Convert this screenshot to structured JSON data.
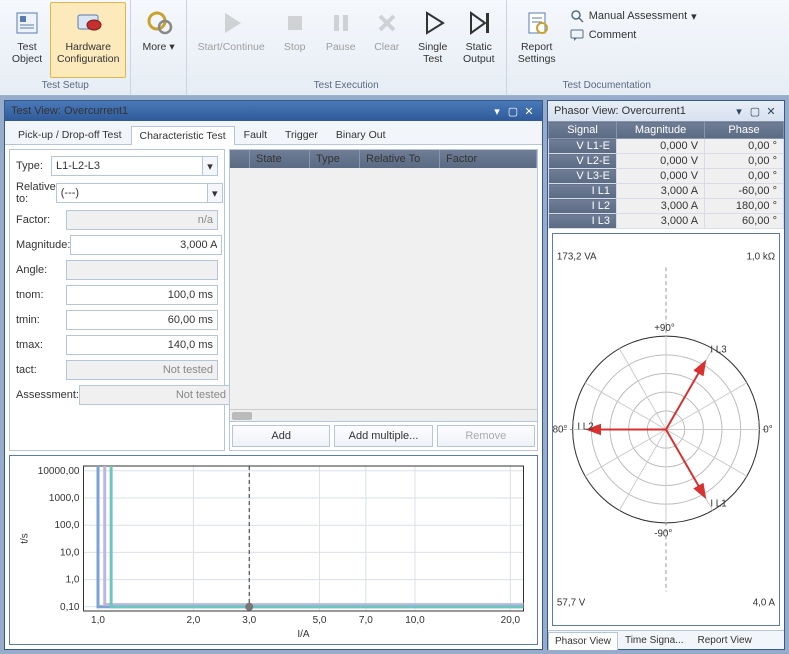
{
  "ribbon": {
    "groups": [
      {
        "label": "Test Setup",
        "buttons": [
          {
            "name": "test-object",
            "label": "Test\nObject",
            "icon": "test-object-icon"
          },
          {
            "name": "hardware-config",
            "label": "Hardware\nConfiguration",
            "icon": "hardware-config-icon",
            "active": true
          }
        ]
      },
      {
        "label": "",
        "buttons": [
          {
            "name": "more",
            "label": "More",
            "icon": "gear-icon",
            "dd": true
          }
        ]
      },
      {
        "label": "Test Execution",
        "buttons": [
          {
            "name": "start",
            "label": "Start/Continue",
            "icon": "play-icon",
            "disabled": true
          },
          {
            "name": "stop",
            "label": "Stop",
            "icon": "stop-icon",
            "disabled": true
          },
          {
            "name": "pause",
            "label": "Pause",
            "icon": "pause-icon",
            "disabled": true
          },
          {
            "name": "clear",
            "label": "Clear",
            "icon": "x-icon",
            "disabled": true
          },
          {
            "name": "single-test",
            "label": "Single\nTest",
            "icon": "play-outline-icon"
          },
          {
            "name": "static-output",
            "label": "Static\nOutput",
            "icon": "playbar-icon"
          }
        ]
      },
      {
        "label": "Test Documentation",
        "buttons": [
          {
            "name": "report-settings",
            "label": "Report\nSettings",
            "icon": "report-icon"
          }
        ],
        "side": [
          {
            "name": "manual-assessment",
            "label": "Manual Assessment",
            "icon": "search-icon",
            "dd": true
          },
          {
            "name": "comment",
            "label": "Comment",
            "icon": "comment-icon"
          }
        ]
      }
    ]
  },
  "testview": {
    "title": "Test View: Overcurrent1",
    "tabs": [
      "Pick-up / Drop-off Test",
      "Characteristic Test",
      "Fault",
      "Trigger",
      "Binary Out"
    ],
    "active_tab": 1,
    "form": {
      "type": {
        "label": "Type:",
        "value": "L1-L2-L3"
      },
      "relative": {
        "label": "Relative to:",
        "value": "(---)"
      },
      "factor": {
        "label": "Factor:",
        "value": "n/a",
        "ro": true
      },
      "magnitude": {
        "label": "Magnitude:",
        "value": "3,000 A"
      },
      "angle": {
        "label": "Angle:",
        "value": "",
        "ro": true
      },
      "tnom": {
        "label": "tnom:",
        "value": "100,0 ms"
      },
      "tmin": {
        "label": "tmin:",
        "value": "60,00 ms"
      },
      "tmax": {
        "label": "tmax:",
        "value": "140,0 ms"
      },
      "tact": {
        "label": "tact:",
        "value": "Not tested",
        "ro": true
      },
      "assessment": {
        "label": "Assessment:",
        "value": "Not tested",
        "ro": true
      }
    },
    "grid": {
      "cols": [
        "",
        "State",
        "Type",
        "Relative To",
        "Factor"
      ]
    },
    "buttons": {
      "add": "Add",
      "addm": "Add multiple...",
      "remove": "Remove"
    }
  },
  "phasorview": {
    "title": "Phasor View: Overcurrent1",
    "table": {
      "headers": [
        "Signal",
        "Magnitude",
        "Phase"
      ],
      "rows": [
        [
          "V L1-E",
          "0,000 V",
          "0,00 °"
        ],
        [
          "V L2-E",
          "0,000 V",
          "0,00 °"
        ],
        [
          "V L3-E",
          "0,000 V",
          "0,00 °"
        ],
        [
          "I L1",
          "3,000 A",
          "-60,00 °"
        ],
        [
          "I L2",
          "3,000 A",
          "180,00 °"
        ],
        [
          "I L3",
          "3,000 A",
          "60,00 °"
        ]
      ]
    },
    "corners": {
      "tl": "173,2  VA",
      "tr": "1,0 kΩ",
      "bl": "57,7  V",
      "br": "4,0  A"
    },
    "vectors": [
      {
        "label": "I L1",
        "deg": -60
      },
      {
        "label": "I L2",
        "deg": 180
      },
      {
        "label": "I L3",
        "deg": 60
      }
    ],
    "tabs": [
      "Phasor View",
      "Time Signa...",
      "Report View"
    ],
    "active_tab": 0
  },
  "chart_data": {
    "type": "line",
    "xlabel": "I/A",
    "ylabel": "t/s",
    "xscale": "log",
    "yscale": "log",
    "xticks": [
      1.0,
      2.0,
      3.0,
      5.0,
      7.0,
      10.0,
      20.0
    ],
    "yticks": [
      0.1,
      1.0,
      10.0,
      100.0,
      1000.0,
      10000.0
    ],
    "xtick_labels": [
      "1,0",
      "2,0",
      "3,0",
      "5,0",
      "7,0",
      "10,0",
      "20,0"
    ],
    "ytick_labels": [
      "0,10",
      "1,0",
      "10,0",
      "100,0",
      "1000,0",
      "10000,00"
    ],
    "xlim": [
      0.9,
      22
    ],
    "ylim": [
      0.07,
      15000
    ],
    "series": [
      {
        "name": "curve-blue",
        "color": "#7ba3d6",
        "x": [
          1.0,
          1.0,
          22
        ],
        "y": [
          15000,
          0.1,
          0.1
        ]
      },
      {
        "name": "curve-lilac",
        "color": "#bcb6e0",
        "x": [
          1.05,
          1.05,
          22
        ],
        "y": [
          15000,
          0.12,
          0.12
        ]
      },
      {
        "name": "curve-teal",
        "color": "#6fc5bf",
        "x": [
          1.1,
          1.1,
          22
        ],
        "y": [
          15000,
          0.1,
          0.1
        ]
      }
    ],
    "markers": [
      {
        "x": 3.0,
        "y": 0.1
      }
    ],
    "vlines": [
      {
        "x": 3.0,
        "style": "dashed"
      }
    ]
  }
}
